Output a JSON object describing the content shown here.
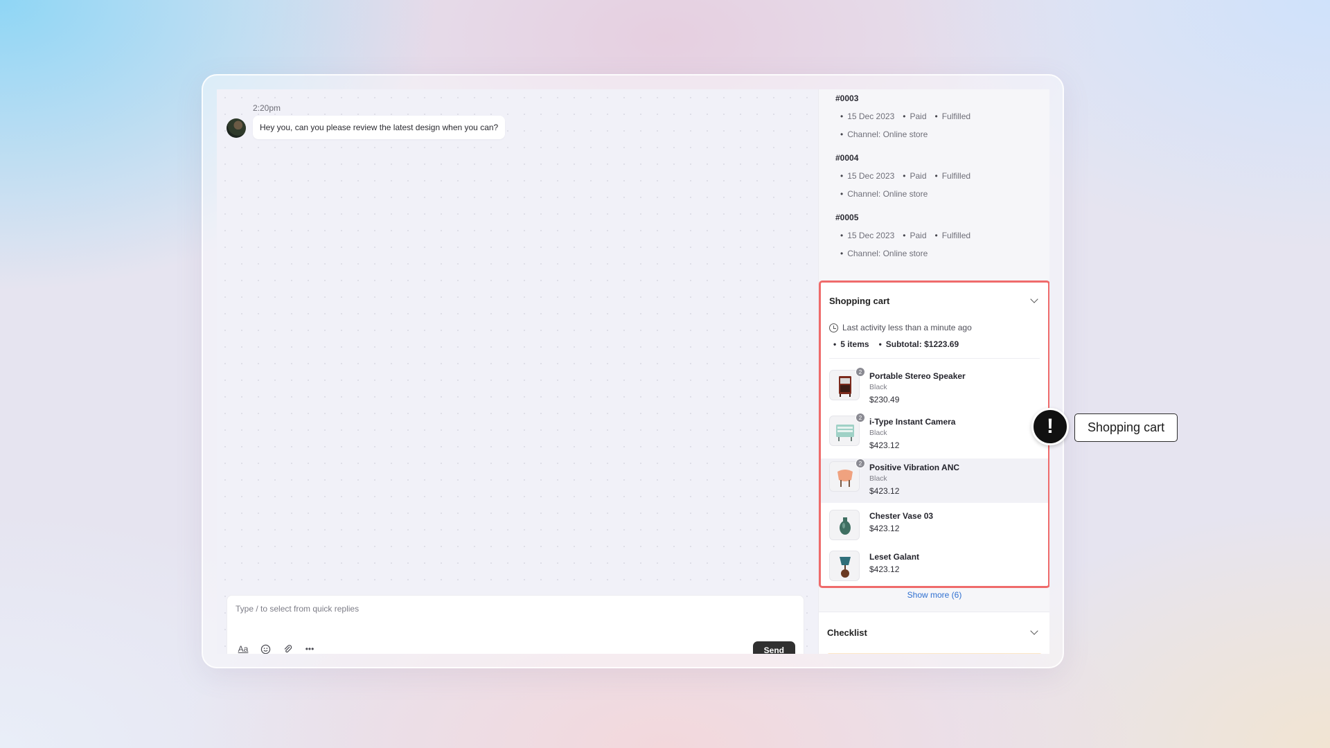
{
  "chat": {
    "message_time": "2:20pm",
    "message_text": "Hey you, can you please review the latest design when you can?",
    "composer_placeholder": "Type / to select from quick replies",
    "tools": {
      "format": "Aa",
      "more": "•••"
    },
    "send_label": "Send"
  },
  "orders": [
    {
      "id": "#0003",
      "date": "15 Dec 2023",
      "payment": "Paid",
      "fulfillment": "Fulfilled",
      "channel": "Channel: Online store"
    },
    {
      "id": "#0004",
      "date": "15 Dec 2023",
      "payment": "Paid",
      "fulfillment": "Fulfilled",
      "channel": "Channel: Online store"
    },
    {
      "id": "#0005",
      "date": "15 Dec 2023",
      "payment": "Paid",
      "fulfillment": "Fulfilled",
      "channel": "Channel: Online store"
    }
  ],
  "cart": {
    "title": "Shopping cart",
    "activity": "Last activity less than a minute ago",
    "item_count": "5 items",
    "subtotal": "Subtotal: $1223.69",
    "items": [
      {
        "name": "Portable Stereo Speaker",
        "variant": "Black",
        "price": "$230.49",
        "qty": "2"
      },
      {
        "name": "i-Type Instant Camera",
        "variant": "Black",
        "price": "$423.12",
        "qty": "2"
      },
      {
        "name": "Positive Vibration ANC",
        "variant": "Black",
        "price": "$423.12",
        "qty": "2"
      },
      {
        "name": "Chester Vase 03",
        "price": "$423.12"
      },
      {
        "name": "Leset Galant",
        "price": "$423.12"
      }
    ],
    "show_more": "Show more (6)"
  },
  "checklist": {
    "title": "Checklist"
  },
  "callout": {
    "icon": "!",
    "label": "Shopping cart"
  },
  "colors": {
    "highlight_border": "#ef6b6b",
    "link": "#2e6fd0",
    "send_button": "#303030"
  }
}
